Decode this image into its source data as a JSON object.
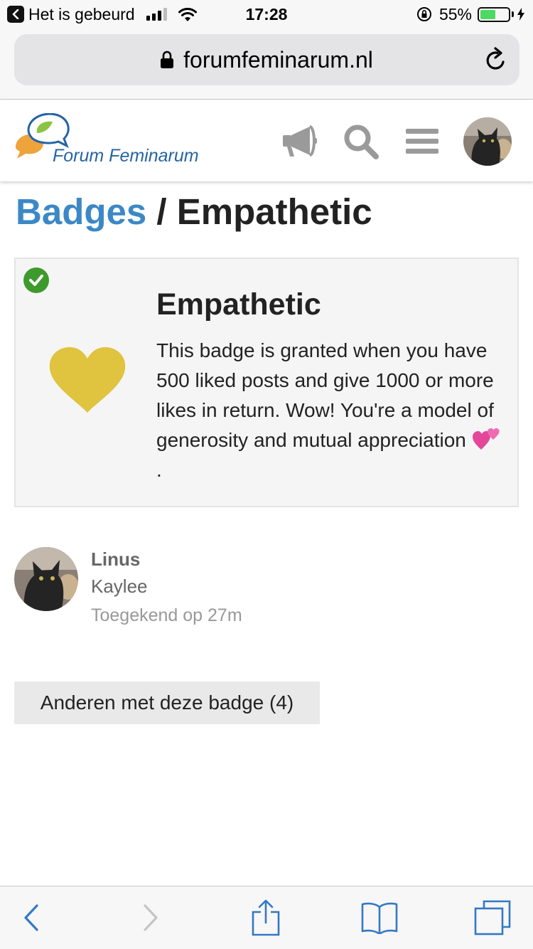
{
  "status_bar": {
    "back_app": "Het is gebeurd",
    "time": "17:28",
    "battery_percent": "55%",
    "battery_level": 0.55,
    "signal_bars_active": 3,
    "signal_bars_total": 4
  },
  "browser": {
    "url": "forumfeminarum.nl"
  },
  "site_header": {
    "logo_text": "Forum Feminarum",
    "icons": [
      "megaphone-icon",
      "search-icon",
      "hamburger-menu-icon",
      "user-avatar"
    ]
  },
  "breadcrumb": {
    "parent": "Badges",
    "separator": " / ",
    "current": "Empathetic"
  },
  "badge": {
    "name": "Empathetic",
    "description": "This badge is granted when you have 500 liked posts and give 1000 or more likes in return. Wow! You're a model of generosity and mutual appreciation",
    "description_end": ".",
    "icon": "heart-icon",
    "icon_color": "#e0c33e",
    "granted_icon": "check-circle-icon",
    "granted_color": "#3d9a2d"
  },
  "grant": {
    "user_name": "Linus",
    "user_title": "Kaylee",
    "granted_text": "Toegekend op 27m"
  },
  "others_button": {
    "label": "Anderen met deze badge (4)"
  },
  "colors": {
    "link": "#3c88c6",
    "ios_accent": "#3478c6"
  }
}
